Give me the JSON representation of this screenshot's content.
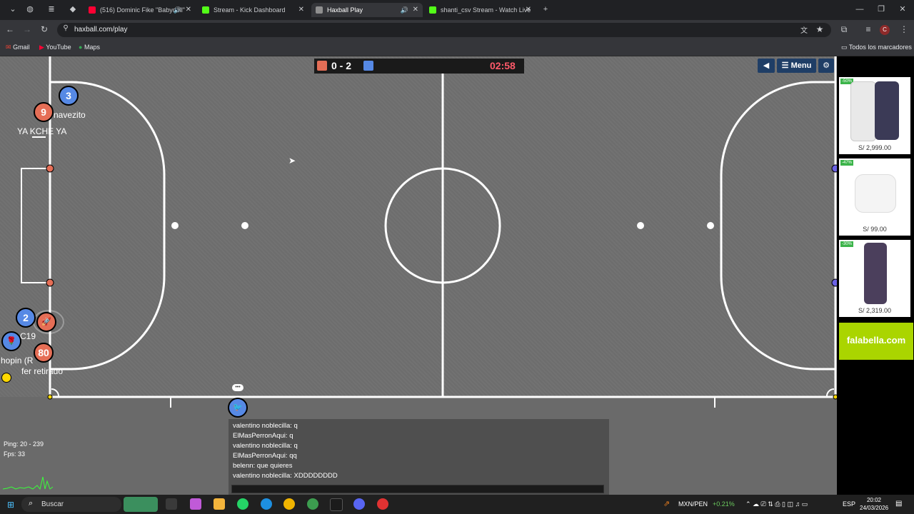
{
  "tabs": [
    {
      "label": "(516) Dominic Fike \"Babydoll\"",
      "active": false,
      "audio": true
    },
    {
      "label": "Stream - Kick Dashboard",
      "active": false,
      "audio": false
    },
    {
      "label": "Haxball Play",
      "active": true,
      "audio": true
    },
    {
      "label": "shanti_csv Stream - Watch Live",
      "active": false,
      "audio": true
    }
  ],
  "address": {
    "url": "haxball.com/play"
  },
  "bookmarks": {
    "items": [
      "Gmail",
      "YouTube",
      "Maps"
    ],
    "all": "Todos los marcadores"
  },
  "score": {
    "text": "0 - 2",
    "timer": "02:58",
    "red_color": "#e56e56",
    "blue_color": "#5689e5"
  },
  "menu": {
    "label": "Menu"
  },
  "players": [
    {
      "number": "3",
      "team": "blue",
      "name": ""
    },
    {
      "number": "9",
      "team": "red",
      "name": "navezito"
    },
    {
      "number": "",
      "team": "",
      "name": "YA KCHE YA"
    },
    {
      "number": "2",
      "team": "blue",
      "name": "C19"
    },
    {
      "number": "80",
      "team": "red",
      "name": "fer retirado"
    },
    {
      "number": "",
      "team": "blue",
      "name": "hopin (R"
    }
  ],
  "stats": {
    "ping": "Ping: 20 - 239",
    "fps": "Fps: 33"
  },
  "chat": [
    "valentino noblecilla: q",
    "ElMasPerronAqui: q",
    "valentino noblecilla: q",
    "ElMasPerronAqui: qq",
    "belenn: que quieres",
    "valentino noblecilla: XDDDDDDDD"
  ],
  "ads": [
    {
      "price": "S/ 2,999.00",
      "badge": "-50%"
    },
    {
      "price": "S/ 99.00",
      "badge": "-47%"
    },
    {
      "price": "S/ 2,319.00",
      "badge": "-30%"
    }
  ],
  "ad_brand": "falabella.com",
  "taskbar": {
    "search": "Buscar",
    "currency": "MXN/PEN",
    "change": "+0.21%",
    "lang": "ESP",
    "time": "20:02",
    "date": "24/03/2026"
  }
}
